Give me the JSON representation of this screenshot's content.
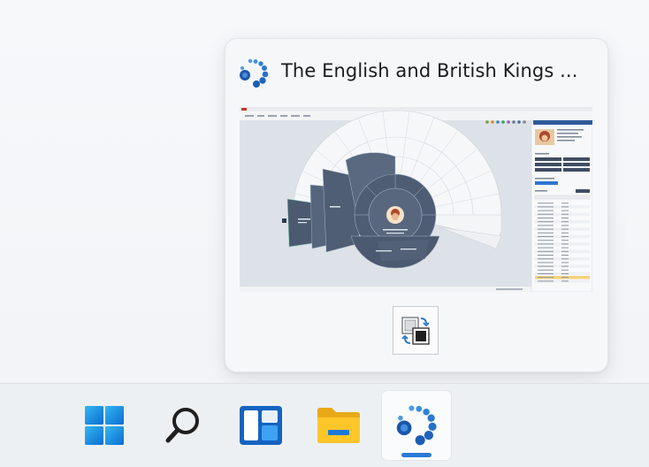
{
  "preview": {
    "window_title": "The English and British Kings ...",
    "app_icon": "family-tree-bubbles-icon",
    "thumbnail_icon": "fan-chart-window-thumbnail",
    "restore_button_icon": "swap-windows-icon"
  },
  "taskbar": {
    "items": [
      {
        "name": "Start",
        "icon": "windows-logo-icon"
      },
      {
        "name": "Search",
        "icon": "search-icon"
      },
      {
        "name": "Widgets",
        "icon": "widgets-icon"
      },
      {
        "name": "File Explorer",
        "icon": "folder-icon"
      },
      {
        "name": "Family tree app",
        "icon": "family-tree-bubbles-icon",
        "active": true
      }
    ],
    "accent": "#2a7ad8"
  }
}
